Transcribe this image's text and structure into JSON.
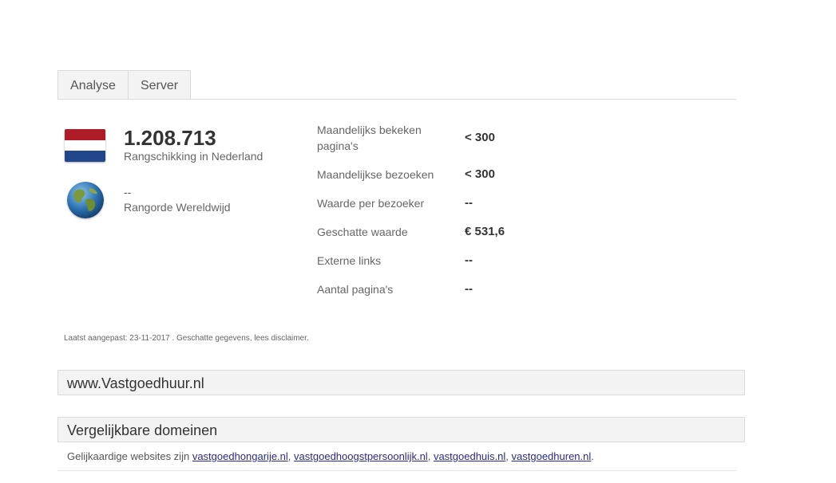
{
  "tabs": [
    {
      "label": "Analyse"
    },
    {
      "label": "Server"
    }
  ],
  "rank_country": {
    "value": "1.208.713",
    "label": "Rangschikking in Nederland",
    "flag_colors": [
      "#ae1c28",
      "#ffffff",
      "#21468b"
    ]
  },
  "rank_world": {
    "value": "--",
    "label": "Rangorde Wereldwijd",
    "icon": "globe-icon"
  },
  "stats": [
    {
      "label": "Maandelijks bekeken pagina's",
      "value": "< 300"
    },
    {
      "label": "Maandelijkse bezoeken",
      "value": "< 300"
    },
    {
      "label": "Waarde per bezoeker",
      "value": "--"
    },
    {
      "label": "Geschatte waarde",
      "value": "€ 531,6"
    },
    {
      "label": "Externe links",
      "value": "--"
    },
    {
      "label": "Aantal pagina's",
      "value": "--"
    }
  ],
  "disclaimer": "Laatst aangepast: 23-11-2017 . Geschatte gegevens, lees disclaimer.",
  "site_panel": {
    "title": "www.Vastgoedhuur.nl"
  },
  "similar_panel": {
    "title": "Vergelijkbare domeinen",
    "prefix": "Gelijkaardige websites zijn",
    "links": [
      "vastgoedhongarije.nl",
      "vastgoedhoogstpersoonlijk.nl",
      "vastgoedhuis.nl",
      "vastgoedhuren.nl"
    ]
  }
}
